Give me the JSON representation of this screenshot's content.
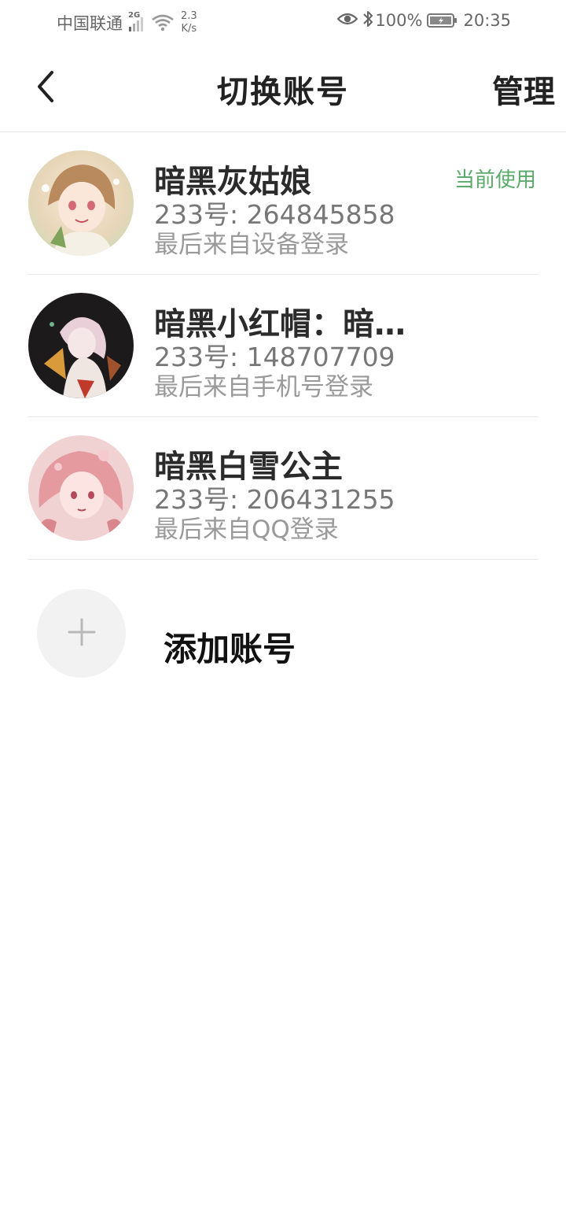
{
  "status_bar": {
    "carrier": "中国联通",
    "network_type": "2G",
    "speed_value": "2.3",
    "speed_unit": "K/s",
    "battery_percent": "100%",
    "time": "20:35",
    "icons": [
      "signal-icon",
      "wifi-icon",
      "eye-icon",
      "bluetooth-icon",
      "battery-icon"
    ]
  },
  "header": {
    "title": "切换账号",
    "manage_label": "管理",
    "back_icon": "chevron-left-icon"
  },
  "accounts": [
    {
      "name": "暗黑灰姑娘",
      "id_text": "233号: 264845858",
      "source_text": "最后来自设备登录",
      "current": false
    },
    {
      "name": "暗黑小红帽：暗黑小红帽",
      "id_text": "233号: 148707709",
      "source_text": "最后来自手机号登录",
      "current": true,
      "current_label": "当前使用"
    },
    {
      "name": "暗黑白雪公主",
      "id_text": "233号: 206431255",
      "source_text": "最后来自QQ登录",
      "current": false
    }
  ],
  "add_account": {
    "label": "添加账号",
    "icon": "plus-icon"
  },
  "colors": {
    "current_badge": "#5aab6b",
    "text_primary": "#2b2b2b",
    "text_secondary": "#777777",
    "text_tertiary": "#9a9a9a",
    "divider": "#e8e8e8"
  }
}
